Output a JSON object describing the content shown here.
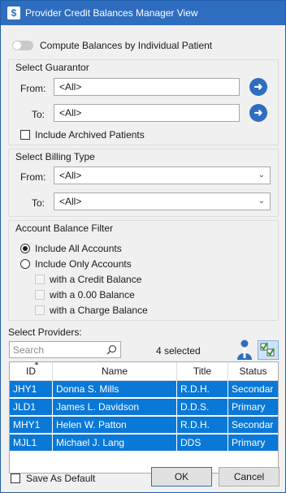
{
  "window": {
    "title": "Provider Credit Balances Manager View",
    "app_icon": "dollar-icon"
  },
  "compute_toggle": {
    "label": "Compute Balances by Individual Patient",
    "on": false
  },
  "guarantor": {
    "title": "Select Guarantor",
    "from_label": "From:",
    "from_value": "<All>",
    "to_label": "To:",
    "to_value": "<All>",
    "include_archived_label": "Include Archived Patients"
  },
  "billing": {
    "title": "Select Billing Type",
    "from_label": "From:",
    "from_value": "<All>",
    "to_label": "To:",
    "to_value": "<All>"
  },
  "balance_filter": {
    "title": "Account Balance Filter",
    "include_all_label": "Include All Accounts",
    "include_only_label": "Include Only Accounts",
    "credit_label": "with a Credit Balance",
    "zero_label": "with a 0.00 Balance",
    "charge_label": "with a Charge Balance"
  },
  "providers": {
    "title": "Select Providers:",
    "search_placeholder": "Search",
    "selected_count": "4 selected",
    "columns": [
      "ID",
      "Name",
      "Title",
      "Status"
    ],
    "rows": [
      {
        "id": "JHY1",
        "name": "Donna S. Mills",
        "title": "R.D.H.",
        "status": "Secondar"
      },
      {
        "id": "JLD1",
        "name": "James L. Davidson",
        "title": "D.D.S.",
        "status": "Primary"
      },
      {
        "id": "MHY1",
        "name": "Helen W. Patton",
        "title": "R.D.H.",
        "status": "Secondar"
      },
      {
        "id": "MJL1",
        "name": "Michael J. Lang",
        "title": "DDS",
        "status": "Primary"
      }
    ]
  },
  "footer": {
    "save_default_label": "Save As Default",
    "ok_label": "OK",
    "cancel_label": "Cancel"
  },
  "colors": {
    "accent": "#2e6dbf",
    "selection": "#0a78d7"
  }
}
